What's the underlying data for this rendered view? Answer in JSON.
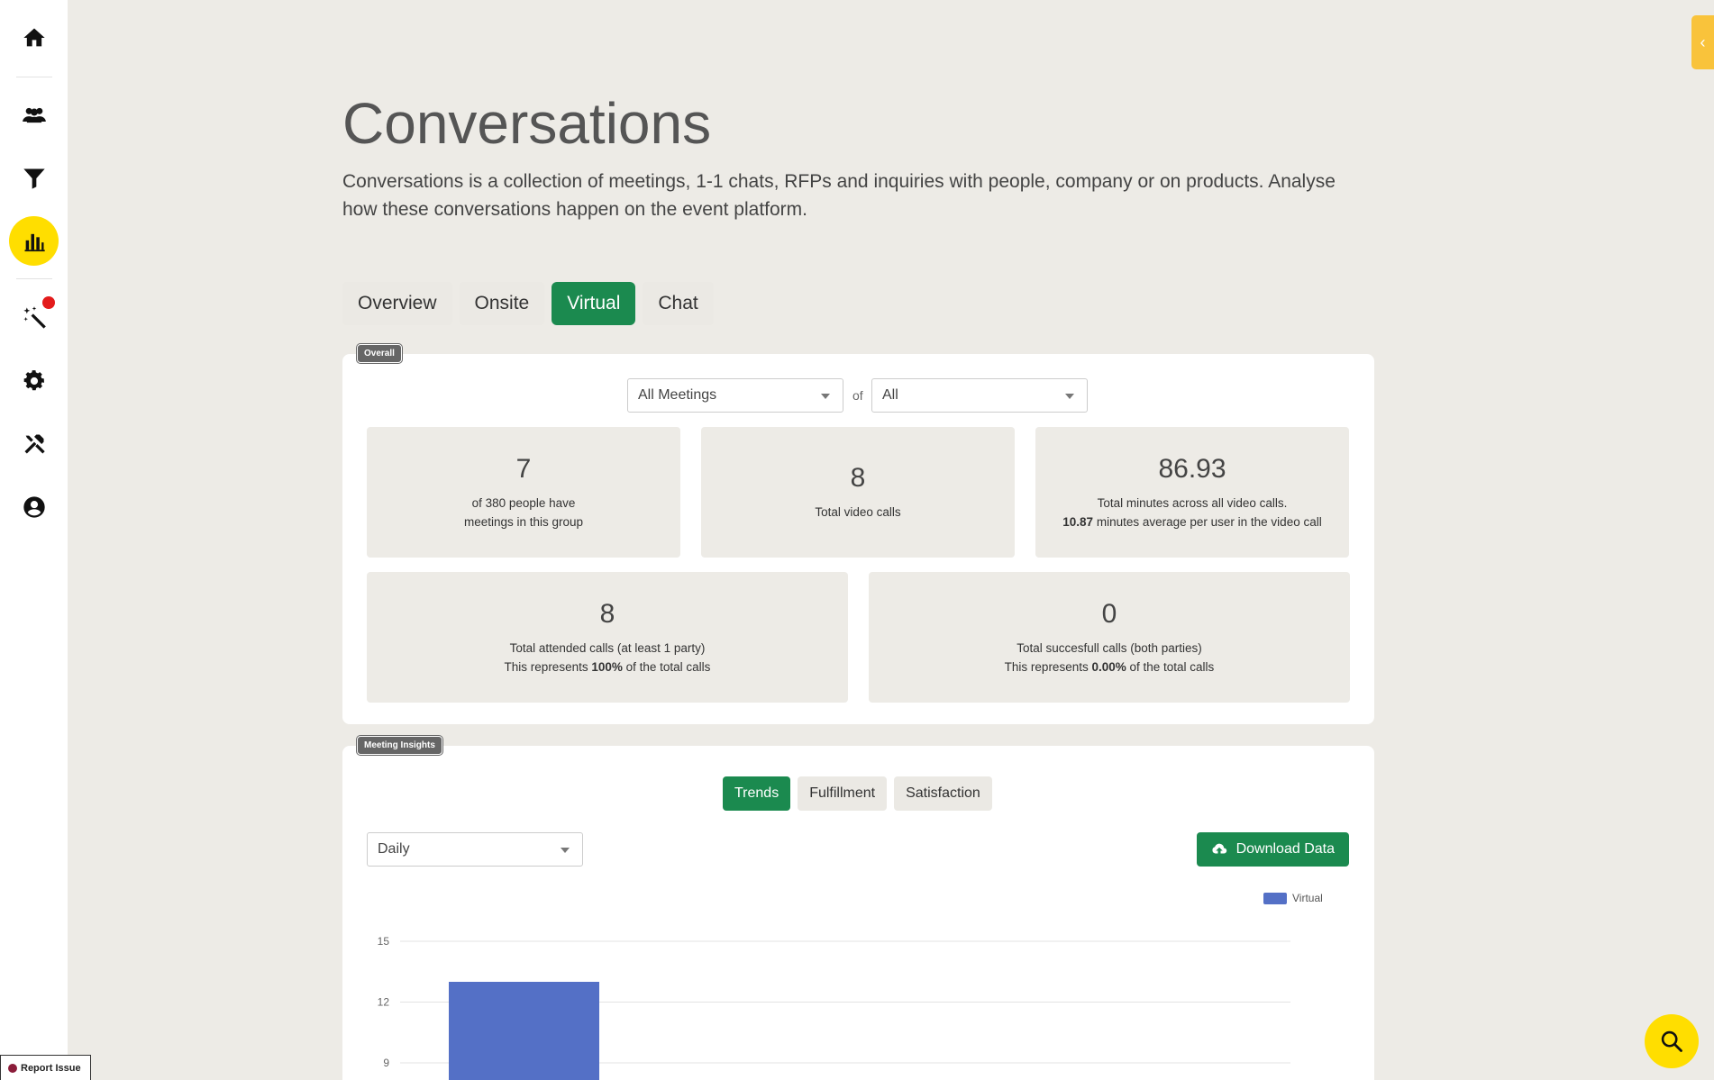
{
  "sidebar": {
    "items": [
      {
        "icon": "home-icon"
      },
      {
        "icon": "people-icon"
      },
      {
        "icon": "filter-icon"
      },
      {
        "icon": "bar-chart-icon",
        "active": true
      },
      {
        "icon": "magic-wand-icon",
        "notification": true
      },
      {
        "icon": "gear-icon"
      },
      {
        "icon": "tools-icon"
      },
      {
        "icon": "user-circle-icon"
      }
    ],
    "report_issue": "Report Issue"
  },
  "header": {
    "title": "Conversations",
    "description": "Conversations is a collection of meetings, 1-1 chats, RFPs and inquiries with people, company or on products. Analyse how these conversations happen on the event platform."
  },
  "tabs": [
    {
      "label": "Overview"
    },
    {
      "label": "Onsite"
    },
    {
      "label": "Virtual",
      "active": true
    },
    {
      "label": "Chat"
    }
  ],
  "overall": {
    "badge": "Overall",
    "meeting_filter": "All Meetings",
    "of_label": "of",
    "group_filter": "All",
    "stats": {
      "people": {
        "value": "7",
        "line1": "of 380 people have",
        "line2": "meetings in this group"
      },
      "video_calls": {
        "value": "8",
        "line1": "Total video calls"
      },
      "minutes": {
        "value": "86.93",
        "line1": "Total minutes across all video calls.",
        "line2_bold": "10.87",
        "line2_rest": " minutes average per user in the video call"
      },
      "attended": {
        "value": "8",
        "line1": "Total attended calls (at least 1 party)",
        "line2_pre": "This represents ",
        "line2_bold": "100%",
        "line2_post": " of the total calls"
      },
      "successful": {
        "value": "0",
        "line1": "Total succesfull calls (both parties)",
        "line2_pre": "This represents ",
        "line2_bold": "0.00%",
        "line2_post": " of the total calls"
      }
    }
  },
  "insights": {
    "badge": "Meeting Insights",
    "subtabs": [
      {
        "label": "Trends",
        "active": true
      },
      {
        "label": "Fulfillment"
      },
      {
        "label": "Satisfaction"
      }
    ],
    "period": "Daily",
    "download_label": "Download Data"
  },
  "chart_data": {
    "type": "bar",
    "series": [
      {
        "name": "Virtual",
        "values": [
          13
        ],
        "color": "#5470c6"
      }
    ],
    "categories": [
      ""
    ],
    "y_ticks": [
      "15",
      "12",
      "9"
    ],
    "ylim": [
      9,
      15
    ],
    "legend": "top-right",
    "grid": true
  }
}
